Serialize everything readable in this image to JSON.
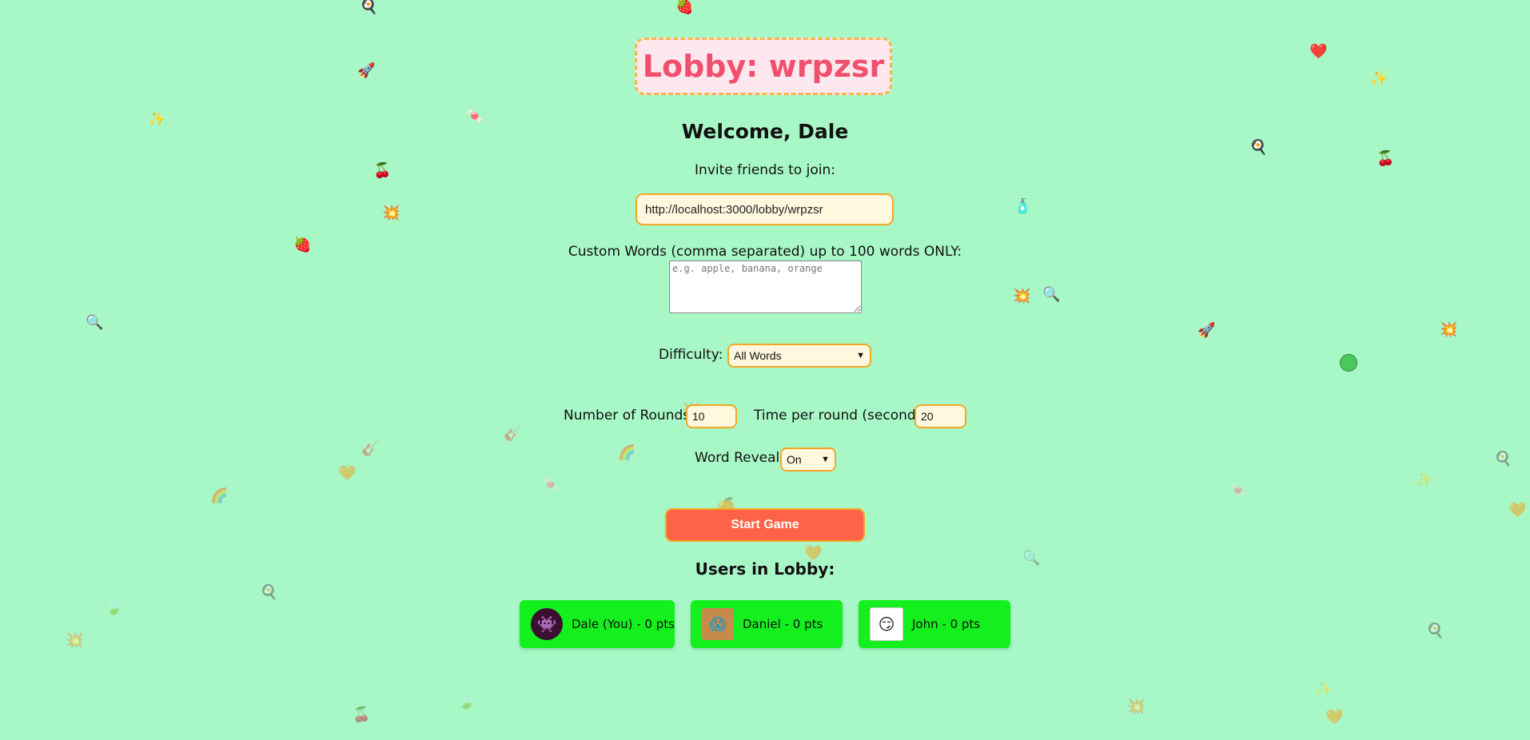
{
  "lobby": {
    "title": "Lobby: wrpzsr",
    "welcome": "Welcome, Dale"
  },
  "invite": {
    "label": "Invite friends to join:",
    "url": "http://localhost:3000/lobby/wrpzsr"
  },
  "custom_words": {
    "label": "Custom Words (comma separated) up to 100 words ONLY:",
    "placeholder": "e.g. apple, banana, orange",
    "value": ""
  },
  "difficulty": {
    "label": "Difficulty:",
    "selected": "All Words"
  },
  "rounds": {
    "label": "Number of Rounds:",
    "value": "10"
  },
  "time_per_round": {
    "label": "Time per round (seconds):",
    "value": "20"
  },
  "word_reveal": {
    "label": "Word Reveal:",
    "selected": "On"
  },
  "start_button": {
    "label": "Start Game"
  },
  "users": {
    "heading": "Users in Lobby:",
    "list": [
      {
        "label": "Dale (You) - 0 pts",
        "avatar": "purple-monster-avatar"
      },
      {
        "label": "Daniel - 0 pts",
        "avatar": "screaming-box-avatar"
      },
      {
        "label": "John - 0 pts",
        "avatar": "sketch-face-avatar"
      }
    ]
  },
  "colors": {
    "background": "#a8f7c6",
    "title": "#f0506e",
    "title_box": "#fde8ef",
    "accent_border": "#f5a623",
    "start_button": "#ff6347",
    "user_card": "#14f01e"
  }
}
